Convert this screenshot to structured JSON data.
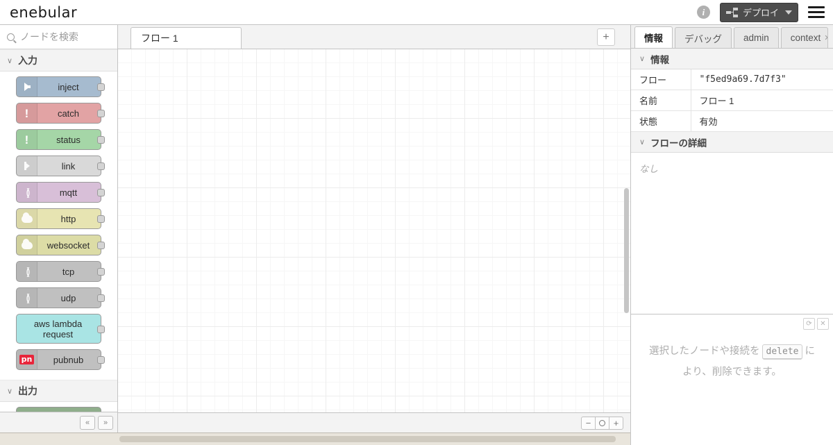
{
  "header": {
    "logo": "enebular",
    "info_icon": "info-icon",
    "deploy_label": "デプロイ",
    "deploy_icon": "deploy-nodes-icon",
    "deploy_caret": "caret-down-icon",
    "menu_icon": "hamburger-menu-icon",
    "deploy_bg": "#4d4d4d"
  },
  "palette": {
    "search_placeholder": "ノードを検索",
    "search_value": "",
    "search_icon": "search-icon",
    "categories": [
      {
        "label": "入力",
        "expanded": true,
        "nodes": [
          {
            "label": "inject",
            "color": "#a6bbcf",
            "icon": "inject-arrow-icon",
            "glyph": "arrow",
            "tall": false,
            "has_icon_box": true
          },
          {
            "label": "catch",
            "color": "#e2a3a4",
            "icon": "catch-alert-icon",
            "glyph": "bang",
            "tall": false,
            "has_icon_box": true
          },
          {
            "label": "status",
            "color": "#a5d6a7",
            "icon": "status-alert-icon",
            "glyph": "bang",
            "tall": false,
            "has_icon_box": true
          },
          {
            "label": "link",
            "color": "#d9d9d9",
            "icon": "link-in-icon",
            "glyph": "link",
            "tall": false,
            "has_icon_box": true
          },
          {
            "label": "mqtt",
            "color": "#d8bfd8",
            "icon": "mqtt-signal-icon",
            "glyph": "wave",
            "tall": false,
            "has_icon_box": true
          },
          {
            "label": "http",
            "color": "#e7e4b2",
            "icon": "http-cloud-icon",
            "glyph": "cloud",
            "tall": false,
            "has_icon_box": true
          },
          {
            "label": "websocket",
            "color": "#dcdca6",
            "icon": "websocket-cloud-icon",
            "glyph": "cloud",
            "tall": false,
            "has_icon_box": true
          },
          {
            "label": "tcp",
            "color": "#c0c0c0",
            "icon": "tcp-signal-icon",
            "glyph": "wave",
            "tall": false,
            "has_icon_box": true
          },
          {
            "label": "udp",
            "color": "#c0c0c0",
            "icon": "udp-signal-icon",
            "glyph": "wave",
            "tall": false,
            "has_icon_box": true
          },
          {
            "label": "aws lambda request",
            "color": "#a9e4e4",
            "icon": "",
            "glyph": "none",
            "tall": true,
            "has_icon_box": false
          },
          {
            "label": "pubnub",
            "color": "#c0c0c0",
            "icon": "pubnub-logo-icon",
            "glyph": "pn",
            "tall": false,
            "has_icon_box": true
          }
        ]
      },
      {
        "label": "出力",
        "expanded": true,
        "nodes": [
          {
            "label": "",
            "color": "#8fae8b",
            "icon": "",
            "glyph": "none",
            "tall": false,
            "has_icon_box": false
          }
        ]
      }
    ],
    "footer": {
      "collapse_all_icon": "chevrons-up-icon",
      "collapse_all_label": "«",
      "expand_all_icon": "chevrons-down-icon",
      "expand_all_label": "»"
    }
  },
  "workspace": {
    "tabs": [
      {
        "label": "フロー 1",
        "active": true
      }
    ],
    "add_tab_label": "+",
    "add_tab_icon": "plus-icon",
    "zoom": {
      "out_label": "−",
      "out_icon": "zoom-out-icon",
      "reset_icon": "zoom-reset-icon",
      "in_label": "+",
      "in_icon": "zoom-in-icon"
    }
  },
  "sidebar": {
    "tabs": [
      {
        "label": "情報",
        "active": true,
        "closable": false
      },
      {
        "label": "デバッグ",
        "active": false,
        "closable": false
      },
      {
        "label": "admin",
        "active": false,
        "closable": false
      },
      {
        "label": "context",
        "active": false,
        "closable": true,
        "close_icon": "close-icon"
      }
    ],
    "info_section": {
      "title": "情報",
      "chevron": "chevron-down-icon",
      "rows": [
        {
          "key": "フロー",
          "value": "\"f5ed9a69.7d7f3\"",
          "mono": true
        },
        {
          "key": "名前",
          "value": "フロー 1",
          "mono": false
        },
        {
          "key": "状態",
          "value": "有効",
          "mono": false
        }
      ]
    },
    "detail_section": {
      "title": "フローの詳細",
      "chevron": "chevron-down-icon",
      "body": "なし"
    },
    "lower": {
      "refresh_icon": "refresh-icon",
      "refresh_label": "⟳",
      "close_icon": "close-icon",
      "close_label": "✕",
      "hint_part1": "選択したノードや接続を",
      "hint_key": "delete",
      "hint_part2": "に",
      "hint_line2": "より、削除できます。"
    }
  }
}
